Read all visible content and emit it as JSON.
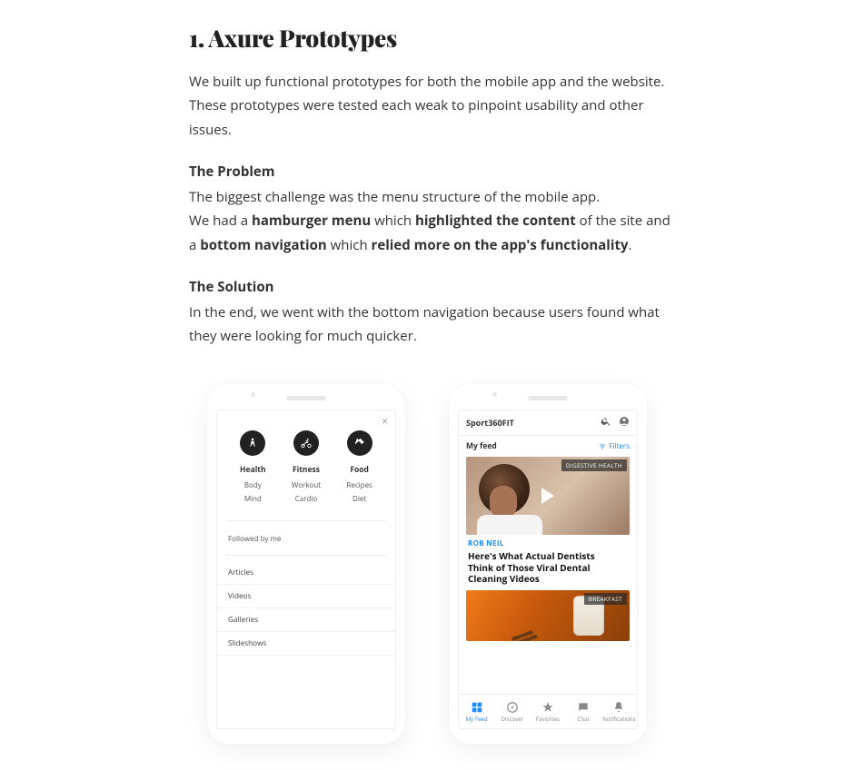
{
  "heading": "1. Axure Prototypes",
  "intro": "We built up functional prototypes for both the mobile app and the website. These prototypes were tested each weak to pinpoint usability and other issues.",
  "problem_label": "The Problem",
  "problem_line1": "The biggest challenge was the menu structure of the mobile app.",
  "problem_line2_a": "We had a ",
  "problem_line2_b": "hamburger menu",
  "problem_line2_c": " which ",
  "problem_line2_d": "highlighted the content",
  "problem_line2_e": " of the site and a ",
  "problem_line2_f": "bottom navigation",
  "problem_line2_g": " which ",
  "problem_line2_h": "relied more on the app's functionality",
  "problem_line2_i": ".",
  "solution_label": "The Solution",
  "solution_text": "In the end, we went with the bottom navigation because users found what they were looking for much quicker.",
  "phone1": {
    "cats": [
      {
        "hd": "Health",
        "subs": [
          "Body",
          "Mind"
        ]
      },
      {
        "hd": "Fitness",
        "subs": [
          "Workout",
          "Cardio"
        ]
      },
      {
        "hd": "Food",
        "subs": [
          "Recipes",
          "Diet"
        ]
      }
    ],
    "followed": "Followed by me",
    "list": [
      "Articles",
      "Videos",
      "Galleries",
      "Slideshows"
    ]
  },
  "phone2": {
    "brand": "Sport360FIT",
    "feed_title": "My feed",
    "filters": "Filters",
    "card1_tag": "DIGESTIVE HEALTH",
    "card1_author": "ROB NEIL",
    "card1_headline": "Here's What Actual Dentists Think of Those Viral Dental Cleaning Videos",
    "card2_tag": "BREAKFAST",
    "tabs": [
      "My Feed",
      "Discover",
      "Favorites",
      "Chat",
      "Notifications"
    ]
  }
}
